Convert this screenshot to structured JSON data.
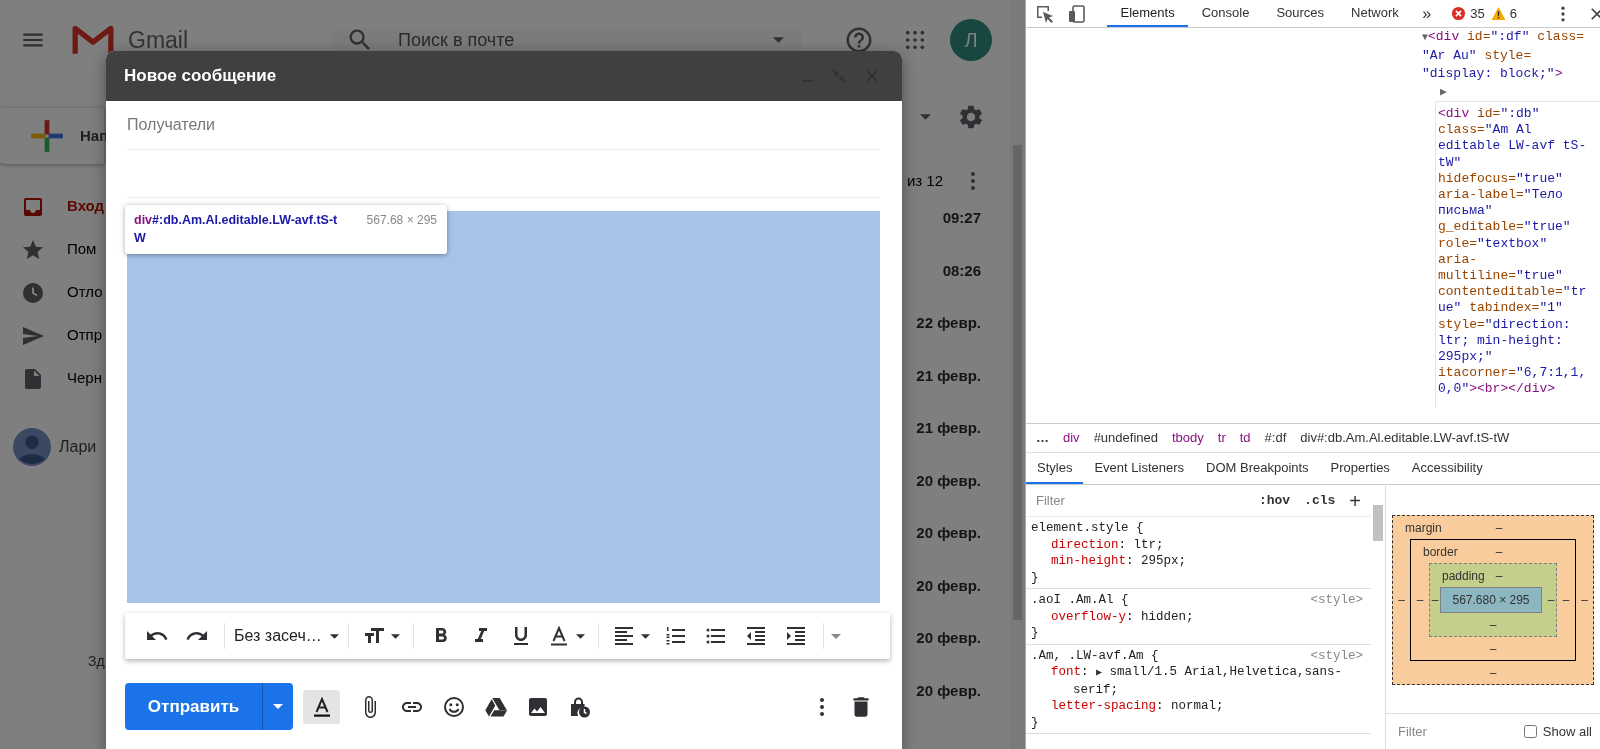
{
  "gmail": {
    "logo_text": "Gmail",
    "search": {
      "placeholder": "Поиск в почте"
    },
    "avatar_letter": "Л",
    "compose_label": "Нап",
    "sidebar": [
      {
        "label": "Вход",
        "selected": true
      },
      {
        "label": "Пом",
        "selected": false
      },
      {
        "label": "Отло",
        "selected": false
      },
      {
        "label": "Отпр",
        "selected": false
      },
      {
        "label": "Черн",
        "selected": false
      }
    ],
    "account": "Лари",
    "footer": "Зд",
    "pagination": "из 12",
    "dates": [
      "09:27",
      "08:26",
      "22 февр.",
      "21 февр.",
      "21 февр.",
      "20 февр.",
      "20 февр.",
      "20 февр.",
      "20 февр.",
      "20 февр."
    ]
  },
  "compose": {
    "title": "Новое сообщение",
    "recipients": {
      "placeholder": "Получатели"
    },
    "tooltip": {
      "tag": "div",
      "selector": "#:db.Am.Al.editable.LW-avf.tS-tW",
      "size": "567.68 × 295"
    },
    "font": "Без засеч…",
    "send": "Отправить",
    "formatting": {
      "selected": true
    }
  },
  "devtools": {
    "tabs": [
      {
        "label": "Elements",
        "selected": true
      },
      {
        "label": "Console",
        "selected": false
      },
      {
        "label": "Sources",
        "selected": false
      },
      {
        "label": "Network",
        "selected": false
      }
    ],
    "overflow": "»",
    "errors": "35",
    "warnings": "6",
    "dom": {
      "lines": [
        [
          {
            "kind": "toggle",
            "text": "▼"
          },
          {
            "kind": "tag",
            "text": "<div "
          },
          {
            "kind": "attr",
            "text": "id="
          },
          {
            "kind": "value",
            "text": "\":df\""
          },
          {
            "kind": "attr",
            "text": " class="
          }
        ],
        [
          {
            "kind": "value",
            "text": "\"Ar Au\""
          },
          {
            "kind": "attr",
            "text": " style="
          }
        ],
        [
          {
            "kind": "value",
            "text": "\"display: block;\""
          },
          {
            "kind": "tag",
            "text": ">"
          }
        ]
      ],
      "expander": "▶",
      "selected_lines": [
        [
          {
            "kind": "tag",
            "text": "<div "
          },
          {
            "kind": "attr",
            "text": "id="
          },
          {
            "kind": "value",
            "text": "\":db\""
          }
        ],
        [
          {
            "kind": "attr",
            "text": "class="
          },
          {
            "kind": "value",
            "text": "\"Am Al"
          }
        ],
        [
          {
            "kind": "value",
            "text": "editable LW-avf tS-"
          }
        ],
        [
          {
            "kind": "value",
            "text": "tW\""
          }
        ],
        [
          {
            "kind": "attr",
            "text": "hidefocus="
          },
          {
            "kind": "value",
            "text": "\"true\""
          }
        ],
        [
          {
            "kind": "attr",
            "text": "aria-label="
          },
          {
            "kind": "value",
            "text": "\"Тело"
          }
        ],
        [
          {
            "kind": "value",
            "text": "письма\""
          }
        ],
        [
          {
            "kind": "attr",
            "text": "g_editable="
          },
          {
            "kind": "value",
            "text": "\"true\""
          }
        ],
        [
          {
            "kind": "attr",
            "text": "role="
          },
          {
            "kind": "value",
            "text": "\"textbox\""
          }
        ],
        [
          {
            "kind": "attr",
            "text": "aria-"
          }
        ],
        [
          {
            "kind": "attr",
            "text": "multiline="
          },
          {
            "kind": "value",
            "text": "\"true\""
          }
        ],
        [
          {
            "kind": "attr",
            "text": "contenteditable="
          },
          {
            "kind": "value",
            "text": "\"tr"
          }
        ],
        [
          {
            "kind": "value",
            "text": "ue\""
          },
          {
            "kind": "attr",
            "text": " tabindex="
          },
          {
            "kind": "value",
            "text": "\"1\""
          }
        ],
        [
          {
            "kind": "attr",
            "text": "style="
          },
          {
            "kind": "value",
            "text": "\"direction:"
          }
        ],
        [
          {
            "kind": "value",
            "text": "ltr; min-height:"
          }
        ],
        [
          {
            "kind": "value",
            "text": "295px;\""
          }
        ],
        [
          {
            "kind": "attr",
            "text": "itacorner="
          },
          {
            "kind": "value",
            "text": "\"6,7:1,1,"
          }
        ],
        [
          {
            "kind": "value",
            "text": "0,0\""
          },
          {
            "kind": "tag",
            "text": "><br></div>"
          }
        ]
      ]
    },
    "breadcrumbs": [
      {
        "kind": "more",
        "text": "…"
      },
      {
        "kind": "tag",
        "text": "div"
      },
      {
        "kind": "node",
        "text": "#undefined"
      },
      {
        "kind": "tag",
        "text": "tbody"
      },
      {
        "kind": "tag",
        "text": "tr"
      },
      {
        "kind": "tag",
        "text": "td"
      },
      {
        "kind": "node",
        "text": "#:df"
      },
      {
        "kind": "node",
        "text": "div#:db.Am.Al.editable.LW-avf.tS-tW"
      }
    ],
    "panes": [
      {
        "label": "Styles",
        "selected": true
      },
      {
        "label": "Event Listeners",
        "selected": false
      },
      {
        "label": "DOM Breakpoints",
        "selected": false
      },
      {
        "label": "Properties",
        "selected": false
      },
      {
        "label": "Accessibility",
        "selected": false
      }
    ],
    "styles": {
      "filter": {
        "placeholder": "Filter"
      },
      "hov": ":hov",
      "cls": ".cls",
      "add": "+",
      "rules": [
        {
          "selector": "element.style {",
          "declarations": [
            {
              "name": "direction",
              "sep": ": ",
              "value": "ltr;"
            },
            {
              "name": "min-height",
              "sep": ": ",
              "value": "295px;"
            }
          ],
          "close": "}"
        },
        {
          "selector": ".aoI .Am.Al {",
          "source": "<style>",
          "declarations": [
            {
              "name": "overflow-y",
              "sep": ": ",
              "value": "hidden;"
            }
          ],
          "close": "}"
        },
        {
          "selector": ".Am, .LW-avf.Am {",
          "source": "<style>",
          "declarations": [
            {
              "name": "font",
              "sep": ": ",
              "toggle": "▶",
              "value": "small/1.5 Arial,Helvetica,sans-serif;"
            },
            {
              "name": "letter-spacing",
              "sep": ": ",
              "value": "normal;"
            }
          ],
          "close": "}"
        }
      ]
    },
    "box_model": {
      "label": "margin",
      "top": "–",
      "left": "–",
      "inner": {
        "label": "border",
        "top": "–",
        "left": "–",
        "inner": {
          "label": "padding",
          "top": "–",
          "left": "–",
          "content": "567.680 × 295",
          "right": "–",
          "bottom": "–"
        },
        "right": "–",
        "bottom": "–"
      },
      "right": "–",
      "bottom": "–"
    },
    "computed": {
      "filter": {
        "placeholder": "Filter"
      },
      "show_all": {
        "label": "Show all",
        "checked": false
      }
    }
  }
}
